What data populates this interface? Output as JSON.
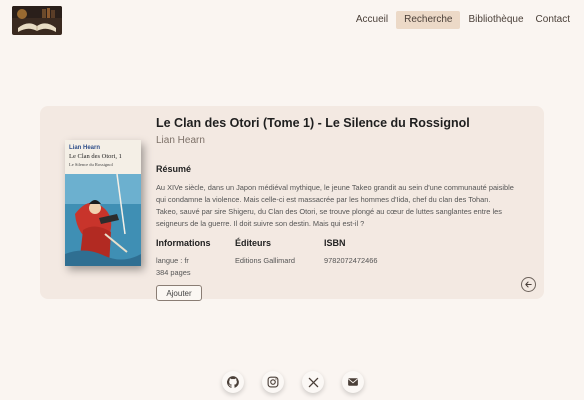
{
  "nav": {
    "items": [
      {
        "label": "Accueil",
        "active": false
      },
      {
        "label": "Recherche",
        "active": true
      },
      {
        "label": "Bibliothèque",
        "active": false
      },
      {
        "label": "Contact",
        "active": false
      }
    ],
    "active_color": "#ecd9c7"
  },
  "book": {
    "title": "Le Clan des Otori (Tome 1) - Le Silence du Rossignol",
    "author": "Lian Hearn",
    "cover": {
      "author": "Lian Hearn",
      "title": "Le Clan des Otori, 1",
      "subtitle": "Le Silence du Rossignol"
    },
    "summary_heading": "Résumé",
    "summary": "Au XIVe siècle, dans un Japon médiéval mythique, le jeune Takeo grandit au sein d'une communauté paisible qui condamne la violence. Mais celle-ci est massacrée par les hommes d'Iida, chef du clan des Tohan. Takeo, sauvé par sire Shigeru, du Clan des Otori, se trouve plongé au cœur de luttes sanglantes entre les seigneurs de la guerre. Il doit suivre son destin. Mais qui est-il ?",
    "info_heading": "Informations",
    "language": "langue : fr",
    "pages": "384 pages",
    "publishers_heading": "Éditeurs",
    "publisher": "Editions Gallimard",
    "isbn_heading": "ISBN",
    "isbn": "9782072472466",
    "add_label": "Ajouter"
  },
  "footer": {
    "icons": [
      "github-icon",
      "instagram-icon",
      "x-icon",
      "email-icon"
    ]
  }
}
